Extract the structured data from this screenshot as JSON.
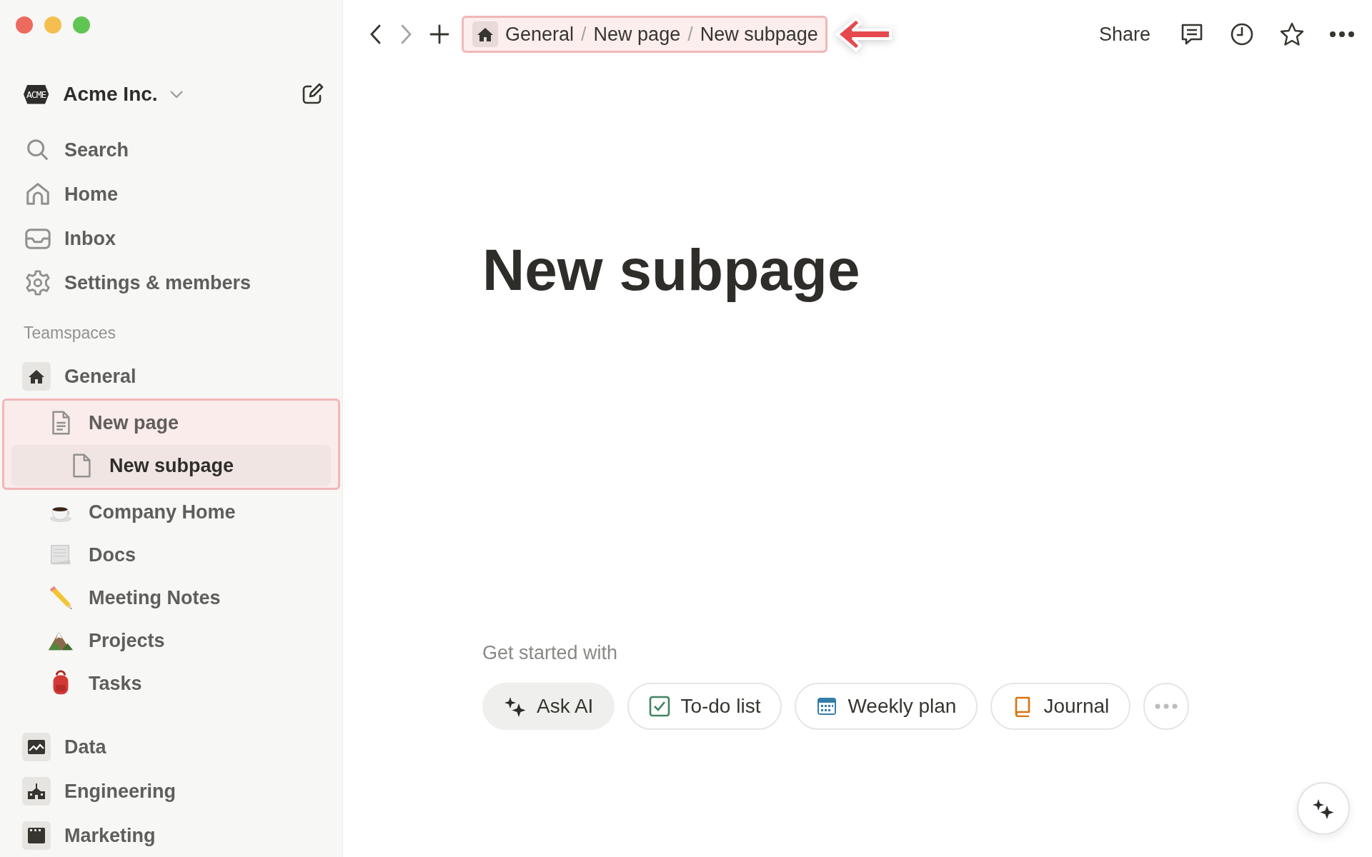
{
  "sidebar": {
    "workspace": {
      "name": "Acme Inc.",
      "logo": "ACME"
    },
    "nav": [
      {
        "label": "Search"
      },
      {
        "label": "Home"
      },
      {
        "label": "Inbox"
      },
      {
        "label": "Settings & members"
      }
    ],
    "section_label": "Teamspaces",
    "teamspaces": [
      {
        "name": "General",
        "children": [
          {
            "name": "New page",
            "selected": false,
            "highlighted": true,
            "children": [
              {
                "name": "New subpage",
                "selected": true
              }
            ]
          },
          {
            "name": "Company Home",
            "selected": false,
            "highlighted": false
          },
          {
            "name": "Docs",
            "selected": false,
            "highlighted": false
          },
          {
            "name": "Meeting Notes",
            "selected": false,
            "highlighted": false
          },
          {
            "name": "Projects",
            "selected": false,
            "highlighted": false
          },
          {
            "name": "Tasks",
            "selected": false,
            "highlighted": false
          }
        ]
      },
      {
        "name": "Data"
      },
      {
        "name": "Engineering"
      },
      {
        "name": "Marketing"
      }
    ]
  },
  "topbar": {
    "breadcrumb": {
      "highlighted": true,
      "pointer_arrow": true,
      "items": [
        {
          "kind": "link",
          "label": "General"
        },
        {
          "kind": "separator",
          "label": "/"
        },
        {
          "kind": "link",
          "label": "New page"
        },
        {
          "kind": "separator",
          "label": "/"
        },
        {
          "kind": "link",
          "label": "New subpage"
        }
      ]
    },
    "share": "Share"
  },
  "page": {
    "title": "New subpage",
    "get_started": "Get started with",
    "templates": [
      {
        "kind": "ai",
        "label": "Ask AI"
      },
      {
        "kind": "todo",
        "label": "To-do list"
      },
      {
        "kind": "calendar",
        "label": "Weekly plan"
      },
      {
        "kind": "journal",
        "label": "Journal"
      },
      {
        "kind": "more"
      }
    ]
  }
}
